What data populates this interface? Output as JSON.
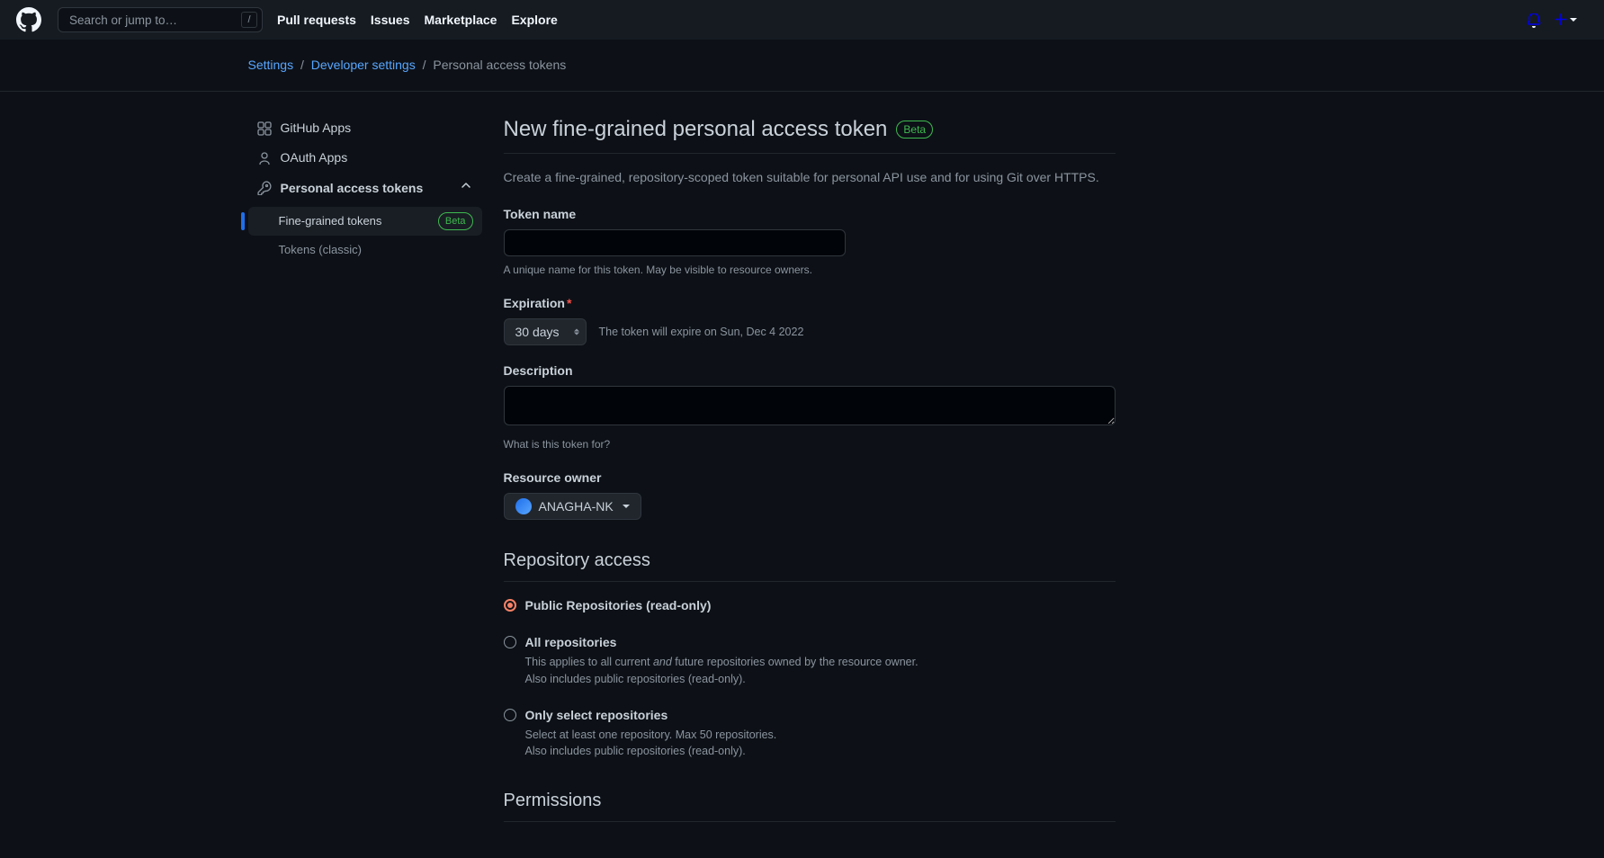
{
  "header": {
    "search_placeholder": "Search or jump to…",
    "nav": {
      "pull_requests": "Pull requests",
      "issues": "Issues",
      "marketplace": "Marketplace",
      "explore": "Explore"
    }
  },
  "breadcrumb": {
    "settings": "Settings",
    "developer_settings": "Developer settings",
    "current": "Personal access tokens"
  },
  "sidebar": {
    "github_apps": "GitHub Apps",
    "oauth_apps": "OAuth Apps",
    "pat": {
      "label": "Personal access tokens",
      "fine_grained": "Fine-grained tokens",
      "fine_grained_badge": "Beta",
      "classic": "Tokens (classic)"
    }
  },
  "main": {
    "title": "New fine-grained personal access token",
    "title_badge": "Beta",
    "intro": "Create a fine-grained, repository-scoped token suitable for personal API use and for using Git over HTTPS.",
    "token_name": {
      "label": "Token name",
      "help": "A unique name for this token. May be visible to resource owners."
    },
    "expiration": {
      "label": "Expiration",
      "value": "30 days",
      "note": "The token will expire on Sun, Dec 4 2022"
    },
    "description": {
      "label": "Description",
      "help": "What is this token for?"
    },
    "resource_owner": {
      "label": "Resource owner",
      "value": "ANAGHA-NK"
    },
    "repo_access": {
      "heading": "Repository access",
      "options": {
        "public": {
          "label": "Public Repositories (read-only)"
        },
        "all": {
          "label": "All repositories",
          "desc_pre": "This applies to all current ",
          "desc_em": "and",
          "desc_post": " future repositories owned by the resource owner.",
          "desc_line2": "Also includes public repositories (read-only)."
        },
        "select": {
          "label": "Only select repositories",
          "desc_line1": "Select at least one repository. Max 50 repositories.",
          "desc_line2": "Also includes public repositories (read-only)."
        }
      }
    },
    "permissions_heading": "Permissions"
  }
}
